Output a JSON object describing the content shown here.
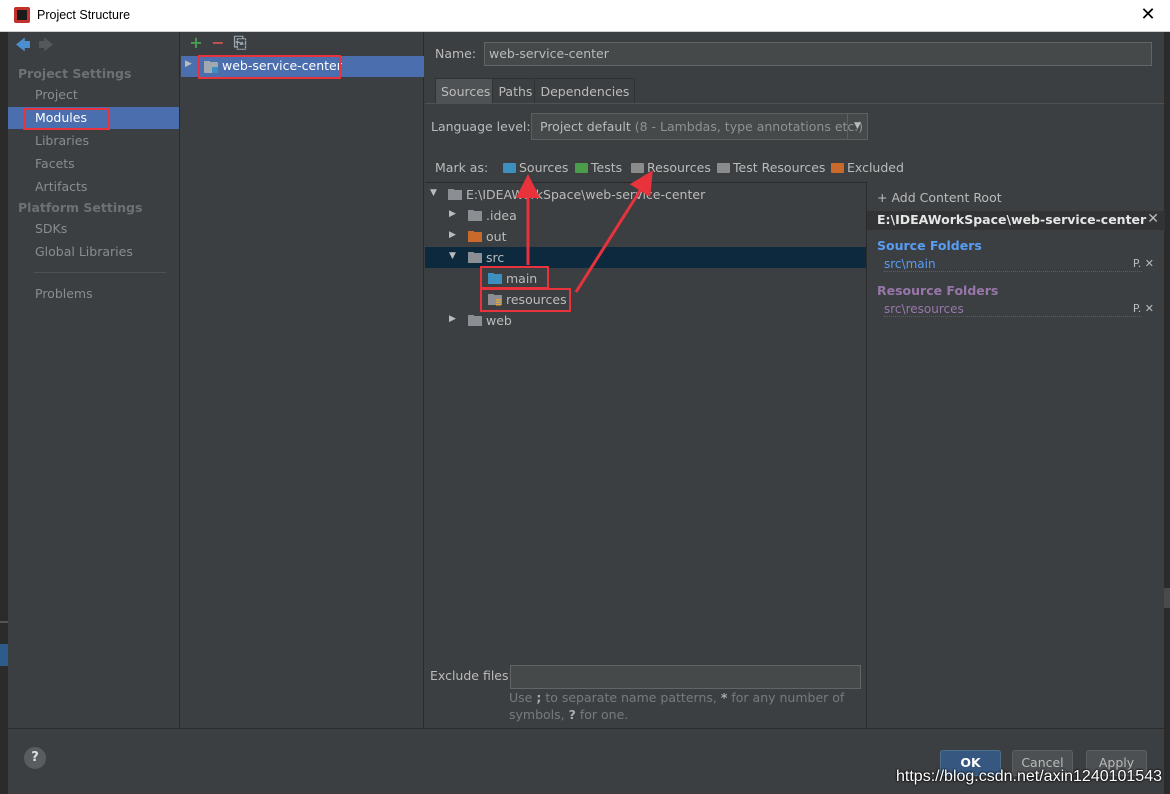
{
  "window": {
    "title": "Project Structure",
    "close_glyph": "✕"
  },
  "nav": {
    "back_glyph": "🡄",
    "forward_glyph": "🡆",
    "section_project": "Project Settings",
    "section_platform": "Platform Settings",
    "items": [
      {
        "label": "Project"
      },
      {
        "label": "Modules"
      },
      {
        "label": "Libraries"
      },
      {
        "label": "Facets"
      },
      {
        "label": "Artifacts"
      },
      {
        "label": "SDKs"
      },
      {
        "label": "Global Libraries"
      },
      {
        "label": "Problems"
      }
    ],
    "selected": "Modules"
  },
  "modules": {
    "toolbar": {
      "add": "+",
      "remove": "−",
      "copy": "⎘"
    },
    "list": [
      {
        "label": "web-service-center"
      }
    ]
  },
  "main": {
    "name_label": "Name:",
    "name_value": "web-service-center",
    "tabs": [
      {
        "label": "Sources"
      },
      {
        "label": "Paths"
      },
      {
        "label": "Dependencies"
      }
    ],
    "active_tab": "Sources",
    "language_label": "Language level:",
    "language_value": "Project default",
    "language_detail": "(8 - Lambdas, type annotations etc.)",
    "mark_as_label": "Mark as:",
    "mark_as": [
      {
        "label": "Sources",
        "color": "#3d8fbf"
      },
      {
        "label": "Tests",
        "color": "#4a9e4a"
      },
      {
        "label": "Resources",
        "color": "#8b8b8b"
      },
      {
        "label": "Test Resources",
        "color": "#8b8b8b"
      },
      {
        "label": "Excluded",
        "color": "#c96a2c"
      }
    ],
    "tree": [
      {
        "label": "E:\\IDEAWorkSpace\\web-service-center"
      },
      {
        "label": ".idea"
      },
      {
        "label": "out"
      },
      {
        "label": "src"
      },
      {
        "label": "main"
      },
      {
        "label": "resources"
      },
      {
        "label": "web"
      }
    ],
    "content_root": {
      "add_label": "Add Content Root",
      "path": "E:\\IDEAWorkSpace\\web-service-center",
      "source_folders_title": "Source Folders",
      "source_folders": [
        "src\\main"
      ],
      "resource_folders_title": "Resource Folders",
      "resource_folders": [
        "src\\resources"
      ],
      "edit_glyph": "P.",
      "remove_glyph": "✕"
    },
    "exclude_label": "Exclude files:",
    "exclude_value": "",
    "hint_part1": "Use",
    "hint_sep": ";",
    "hint_part2": "to separate name patterns,",
    "hint_star": "*",
    "hint_part3": "for any number of symbols,",
    "hint_q": "?",
    "hint_part4": "for one."
  },
  "footer": {
    "help": "?",
    "ok": "OK",
    "cancel": "Cancel",
    "apply": "Apply",
    "watermark": "https://blog.csdn.net/axin1240101543"
  },
  "colors": {
    "selection": "#4b6eaf",
    "annotation_red": "#e8323c",
    "source_folder_blue": "#589df6",
    "resource_folder_purple": "#9876aa"
  }
}
